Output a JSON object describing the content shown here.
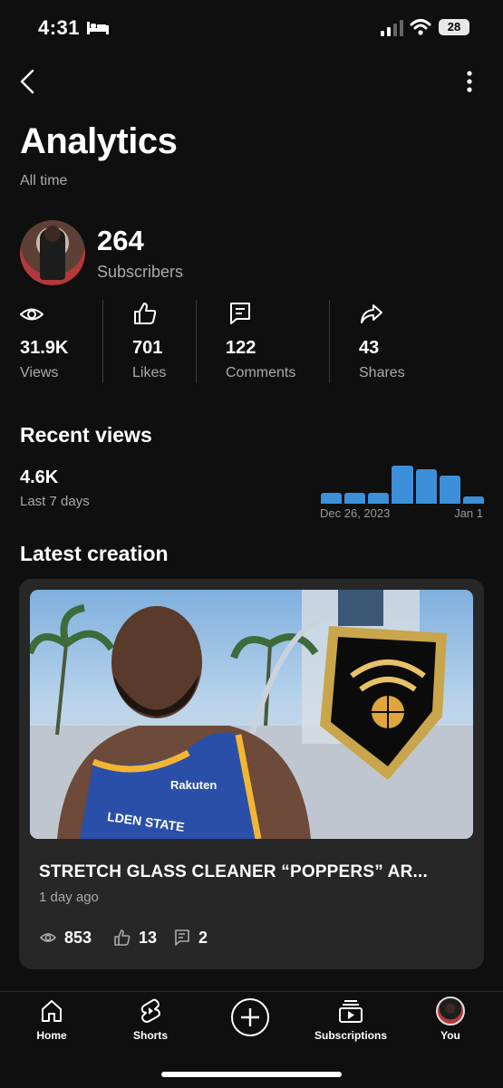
{
  "status": {
    "time": "4:31",
    "battery": "28"
  },
  "header": {
    "title": "Analytics",
    "subtitle": "All time"
  },
  "channel": {
    "subscribers": "264",
    "subscribers_label": "Subscribers"
  },
  "stats": [
    {
      "icon": "eye-icon",
      "value": "31.9K",
      "label": "Views"
    },
    {
      "icon": "thumbs-up-icon",
      "value": "701",
      "label": "Likes"
    },
    {
      "icon": "comment-icon",
      "value": "122",
      "label": "Comments"
    },
    {
      "icon": "share-icon",
      "value": "43",
      "label": "Shares"
    }
  ],
  "recent_views": {
    "title": "Recent views",
    "value": "4.6K",
    "label": "Last 7 days",
    "axis_start": "Dec 26, 2023",
    "axis_end": "Jan 1"
  },
  "chart_data": {
    "type": "bar",
    "categories": [
      "",
      "",
      "",
      "",
      "",
      "",
      ""
    ],
    "values": [
      0.26,
      0.26,
      0.26,
      0.9,
      0.82,
      0.66,
      0.18
    ],
    "color": "#3e8fd9",
    "xlabel": "",
    "ylabel": ""
  },
  "latest_creation": {
    "section_title": "Latest creation",
    "video_title": "STRETCH GLASS CLEANER “POPPERS” AR...",
    "posted": "1 day ago",
    "views": "853",
    "likes": "13",
    "comments": "2",
    "thumbnail_text": "Rakuten",
    "jersey_text": "LDEN STATE"
  },
  "nav": [
    {
      "label": "Home",
      "icon": "home-icon"
    },
    {
      "label": "Shorts",
      "icon": "shorts-icon"
    },
    {
      "label": "",
      "icon": "create-plus-icon"
    },
    {
      "label": "Subscriptions",
      "icon": "subscriptions-icon"
    },
    {
      "label": "You",
      "icon": "you-avatar-icon"
    }
  ],
  "colors": {
    "background": "#0f0f0f",
    "card": "#272727",
    "accent": "#3e8fd9",
    "muted": "#aaaaaa"
  }
}
